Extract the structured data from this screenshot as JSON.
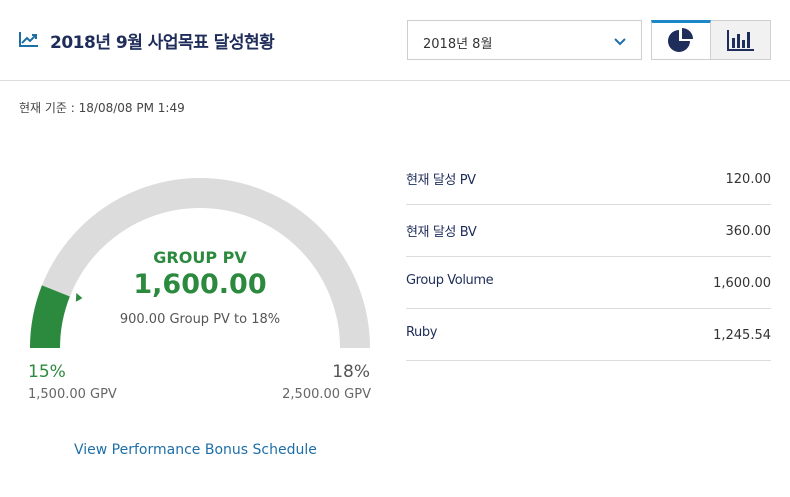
{
  "header": {
    "title": "2018년 9월 사업목표 달성현황",
    "title_icon": "trend-up-icon",
    "month_select": {
      "value": "2018년 8월",
      "icon": "chevron-down-icon"
    },
    "view_toggle": {
      "active": "pie",
      "pie_icon": "pie-chart-icon",
      "bar_icon": "bar-chart-icon"
    }
  },
  "timestamp": "현재 기준 : 18/08/08 PM 1:49",
  "gauge": {
    "title": "GROUP PV",
    "value": "1,600.00",
    "subtitle": "900.00 Group PV to 18%",
    "progress_fraction": 0.12,
    "min_percent": "15%",
    "min_gpv": "1,500.00 GPV",
    "max_percent": "18%",
    "max_gpv": "2,500.00 GPV"
  },
  "stats": [
    {
      "label": "현재 달성 PV",
      "value": "120.00"
    },
    {
      "label": "현재 달성 BV",
      "value": "360.00"
    },
    {
      "label": "Group Volume",
      "value": "1,600.00"
    },
    {
      "label": "Ruby",
      "value": "1,245.54"
    }
  ],
  "bonus_link": "View Performance Bonus Schedule",
  "colors": {
    "accent_green": "#2b8a3e",
    "gauge_track": "#dcdcdc",
    "navy": "#1f2d5a",
    "link_blue": "#1e6fa8",
    "toggle_active": "#1e88c7"
  }
}
